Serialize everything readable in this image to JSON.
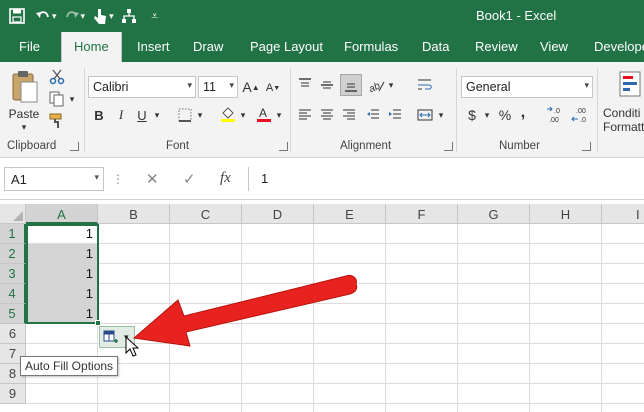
{
  "titlebar": {
    "title": "Book1  -  Excel",
    "qat": [
      "save-icon",
      "undo-icon",
      "redo-icon",
      "touch-mode-icon",
      "tree-icon",
      "customize-qat-icon"
    ]
  },
  "tabs": [
    "File",
    "Home",
    "Insert",
    "Draw",
    "Page Layout",
    "Formulas",
    "Data",
    "Review",
    "View",
    "Develope"
  ],
  "ribbon": {
    "clipboard": {
      "label": "Clipboard",
      "paste": "Paste"
    },
    "font": {
      "label": "Font",
      "name": "Calibri",
      "size": "11"
    },
    "alignment": {
      "label": "Alignment"
    },
    "number": {
      "label": "Number",
      "format": "General",
      "currency": "$",
      "percent": "%",
      "comma": ",",
      "inc_decimals": ".00→.0",
      "dec_decimals": ".0→.00"
    },
    "styles": {
      "label_line1": "Conditi",
      "label_line2": "Formatti"
    }
  },
  "formula_bar": {
    "name_box": "A1",
    "fx": "fx",
    "value": "1"
  },
  "grid": {
    "columns": [
      "A",
      "B",
      "C",
      "D",
      "E",
      "F",
      "G",
      "H",
      "I"
    ],
    "rows": [
      "1",
      "2",
      "3",
      "4",
      "5",
      "6",
      "7",
      "8",
      "9"
    ],
    "cells": [
      {
        "ref": "A1",
        "value": "1"
      },
      {
        "ref": "A2",
        "value": "1"
      },
      {
        "ref": "A3",
        "value": "1"
      },
      {
        "ref": "A4",
        "value": "1"
      },
      {
        "ref": "A5",
        "value": "1"
      }
    ]
  },
  "autofill": {
    "tooltip": "Auto Fill Options"
  },
  "colors": {
    "brand": "#217346",
    "annotation_arrow": "#e8231f",
    "selection_fill": "#d4d4d4"
  }
}
